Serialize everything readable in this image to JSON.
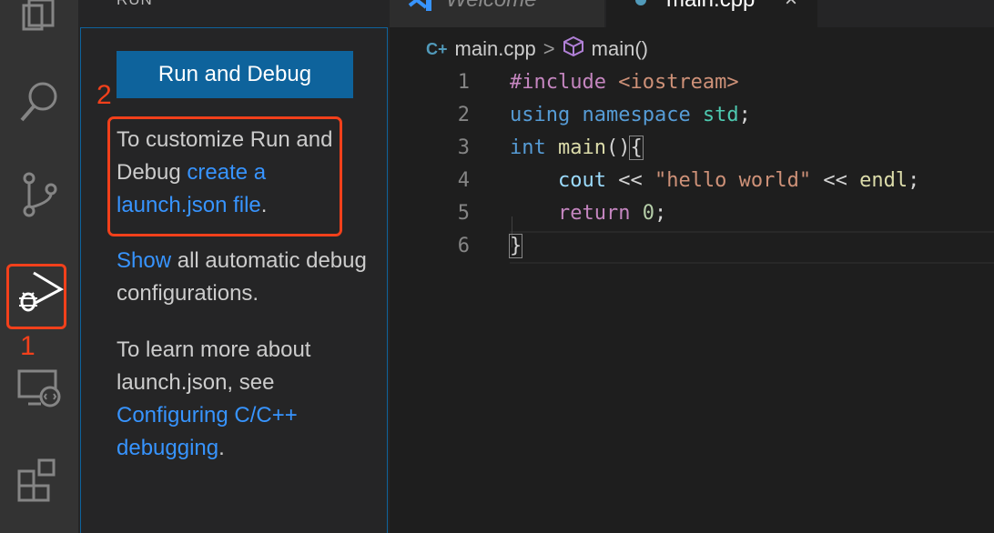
{
  "activity_bar": {
    "items": [
      {
        "icon": "explorer-icon"
      },
      {
        "icon": "search-icon"
      },
      {
        "icon": "source-control-icon"
      },
      {
        "icon": "run-debug-icon",
        "active": true
      },
      {
        "icon": "remote-explorer-icon"
      },
      {
        "icon": "extensions-icon"
      }
    ],
    "annotation": "1"
  },
  "sidebar": {
    "title": "RUN",
    "run_button": "Run and Debug",
    "annotation": "2",
    "p1_text": "To customize Run and Debug ",
    "p1_link": "create a launch.json file",
    "p1_end": ".",
    "p2_link": "Show",
    "p2_text": " all automatic debug configurations.",
    "p3_text": "To learn more about launch.json, see ",
    "p3_link": "Configuring C/C++ debugging",
    "p3_end": "."
  },
  "tabs": [
    {
      "label": "Welcome",
      "active": false
    },
    {
      "label": "main.cpp",
      "active": true,
      "close": "×"
    }
  ],
  "breadcrumb": {
    "file": "main.cpp",
    "separator": ">",
    "symbol": "main()"
  },
  "editor": {
    "line_numbers": [
      "1",
      "2",
      "3",
      "4",
      "5",
      "6"
    ],
    "lines": [
      {
        "a": "#include",
        "b": " <iostream>"
      },
      {
        "a": "using",
        "b": " namespace",
        "c": " std",
        "d": ";"
      },
      {
        "a": "int",
        "b": " main",
        "c": "()",
        "d": "{"
      },
      {
        "indent": "    ",
        "a": "cout",
        "b": " << ",
        "c": "\"hello world\"",
        "d": " << ",
        "e": "endl",
        "f": ";"
      },
      {
        "indent": "    ",
        "a": "return",
        "b": " ",
        "c": "0",
        "d": ";"
      },
      {
        "a": "}"
      }
    ]
  },
  "colors": {
    "accent": "#0e639c",
    "link": "#3794ff",
    "annotation": "#f2401b"
  }
}
